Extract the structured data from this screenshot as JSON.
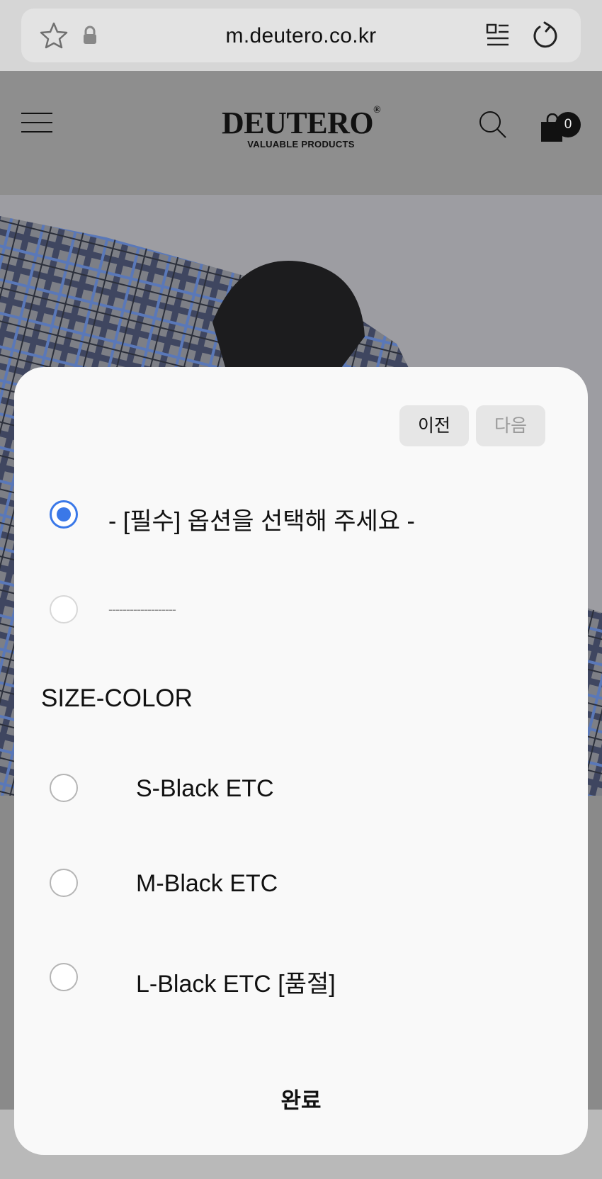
{
  "browser": {
    "url": "m.deutero.co.kr"
  },
  "header": {
    "logo": "DEUTERO",
    "logo_mark": "®",
    "tagline": "VALUABLE PRODUCTS",
    "cart_count": "0"
  },
  "option_sheet": {
    "prev_label": "이전",
    "next_label": "다음",
    "options_top": [
      {
        "label": "- [필수] 옵션을 선택해 주세요 -",
        "selected": true
      },
      {
        "label": "-------------------",
        "selected": false,
        "disabled": true
      }
    ],
    "group_label": "SIZE-COLOR",
    "group_options": [
      {
        "label": "S-Black ETC",
        "selected": false
      },
      {
        "label": "M-Black ETC",
        "selected": false
      },
      {
        "label": "L-Black ETC [품절]",
        "selected": false
      }
    ],
    "done_label": "완료"
  },
  "colors": {
    "radio_selected": "#3a78e8"
  }
}
